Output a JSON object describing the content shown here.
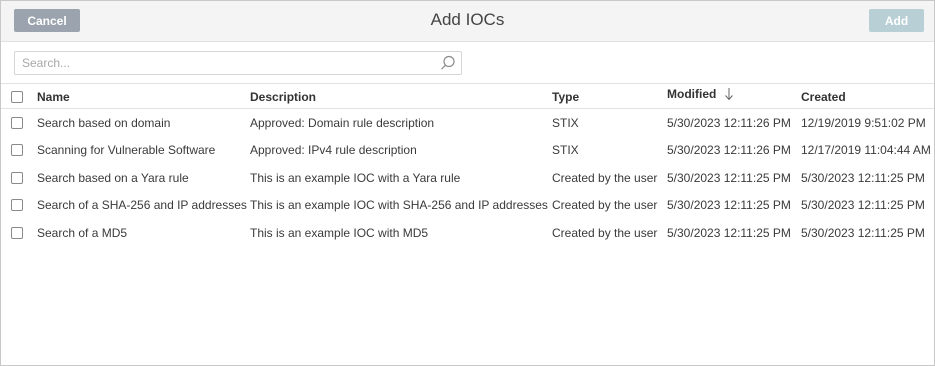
{
  "header": {
    "cancel_label": "Cancel",
    "title": "Add IOCs",
    "add_label": "Add"
  },
  "search": {
    "placeholder": "Search..."
  },
  "table": {
    "columns": {
      "name": "Name",
      "description": "Description",
      "type": "Type",
      "modified": "Modified",
      "created": "Created"
    },
    "sort": {
      "column": "modified",
      "direction": "desc",
      "icon": "arrow-down-icon"
    },
    "rows": [
      {
        "name": "Search based on domain",
        "description": "Approved: Domain rule description",
        "type": "STIX",
        "modified": "5/30/2023 12:11:26 PM",
        "created": "12/19/2019 9:51:02 PM"
      },
      {
        "name": "Scanning for Vulnerable Software",
        "description": "Approved: IPv4 rule description",
        "type": "STIX",
        "modified": "5/30/2023 12:11:26 PM",
        "created": "12/17/2019 11:04:44 AM"
      },
      {
        "name": "Search based on a Yara rule",
        "description": "This is an example IOC with a Yara rule",
        "type": "Created by the user",
        "modified": "5/30/2023 12:11:25 PM",
        "created": "5/30/2023 12:11:25 PM"
      },
      {
        "name": "Search of a SHA-256 and IP addresses",
        "description": "This is an example IOC with SHA-256 and IP addresses",
        "type": "Created by the user",
        "modified": "5/30/2023 12:11:25 PM",
        "created": "5/30/2023 12:11:25 PM"
      },
      {
        "name": "Search of a MD5",
        "description": "This is an example IOC with MD5",
        "type": "Created by the user",
        "modified": "5/30/2023 12:11:25 PM",
        "created": "5/30/2023 12:11:25 PM"
      }
    ]
  },
  "colors": {
    "cancel_button": "#9ba3ae",
    "add_button": "#b8cfd6",
    "header_bg": "#f4f4f4"
  }
}
